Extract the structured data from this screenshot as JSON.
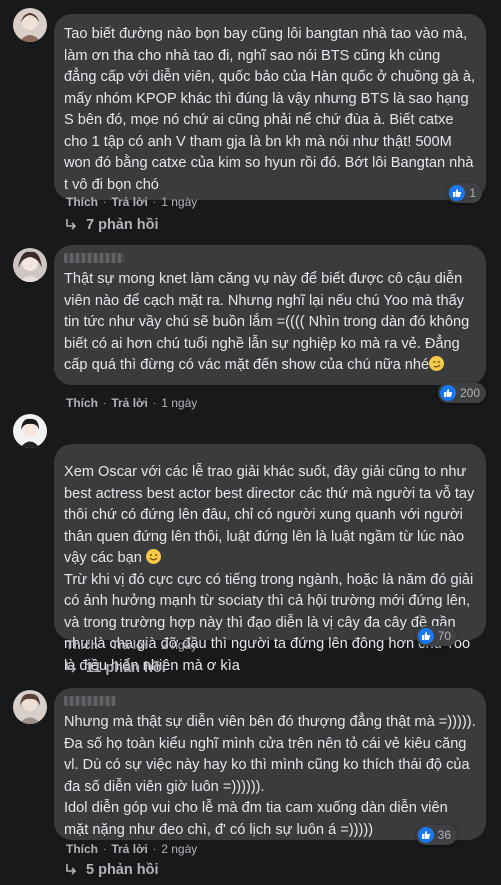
{
  "comments": [
    {
      "text": "Tao biết đường nào bọn bay cũng lôi bangtan nhà tao vào mà, làm ơn tha cho nhà tao đi, nghĩ sao nói BTS cũng kh cùng đẳng cấp với diễn viên, quốc bảo của Hàn quốc ở chuồng gà à, mấy nhóm KPOP khác thì đúng là vậy nhưng BTS là sao hạng S bên đó, mọe nó chứ ai cũng phải nể chứ đùa à. Biết catxe cho 1 tập có anh V tham gja là bn kh mà nói như thật! 500M won đó bằng catxe của kim so hyun rồi đó. Bớt lôi Bangtan nhà t vô đi bọn chó",
      "reaction_count": "1",
      "like": "Thích",
      "reply": "Trả lời",
      "time": "1 ngày",
      "replies": "7 phản hồi"
    },
    {
      "text": "Thật sự mong knet làm căng vụ này để biết được cô cậu diễn viên nào để cạch mặt ra. Nhưng nghĩ lại nếu chú Yoo mà thấy tin tức như vầy chú sẽ buồn lắm =(((( Nhìn trong dàn đó không biết có ai hơn chú tuổi nghề lẫn sự nghiệp ko mà ra vẻ. Đẳng cấp quá thì đừng có vác mặt đến show của chú nữa nhé",
      "reaction_count": "200",
      "like": "Thích",
      "reply": "Trả lời",
      "time": "1 ngày"
    },
    {
      "text": "Xem Oscar với các lễ trao giải khác suốt, đây giải cũng to như best actress best actor best director các thứ mà người ta vỗ tay thôi chứ có đứng lên đâu, chỉ có người xung quanh với người thân quen đứng lên thôi, luật đứng lên là luật ngầm từ lúc nào vậy các bạn",
      "text2": "Trừ khi vị đó cực cực có tiếng trong ngành, hoặc là năm đó giải có ảnh hưởng mạnh từ sociaty thì cả hội trường mới đứng lên, và trong trường hợp này thì đạo diễn là vị cây đa cây đề gần như là cha già đỡ đầu thì người ta đứng lên đông hơn chú Yoo là điều hiển nhiên mà ơ kìa",
      "reaction_count": "70",
      "like": "Thích",
      "reply": "Trả lời",
      "time": "2 ngày",
      "replies": "11 phản hồi"
    },
    {
      "text": "Nhưng mà thật sự diễn viên bên đó thượng đẳng thật mà =))))). Đa số họ toàn kiểu nghĩ mình cửa trên nên tỏ cái vẻ kiêu căng vl. Dù có sự việc này hay ko thì mình cũng ko thích thái độ của đa số diễn viên giờ luôn =)))))).",
      "text2": "Idol diễn góp vui cho lễ mà đm tia cam xuống dàn diễn viên mặt nặng như đeo chì, đ' có lịch sự luôn á =)))))",
      "reaction_count": "36",
      "like": "Thích",
      "reply": "Trả lời",
      "time": "2 ngày",
      "replies": "5 phản hồi"
    }
  ],
  "colors": {
    "background": "#18191a",
    "bubble": "#3a3b3c",
    "text": "#e4e6eb",
    "secondary": "#b0b3b8",
    "like": "#1877f2"
  },
  "icons": [
    "like-icon",
    "reply-arrow-icon",
    "smirk-emoji",
    "smile-emoji"
  ]
}
